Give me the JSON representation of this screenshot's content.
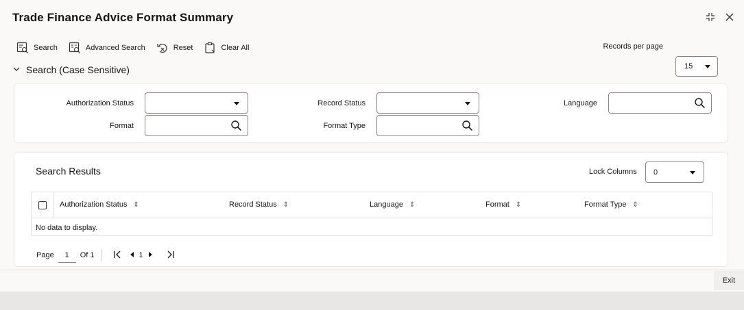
{
  "window": {
    "title": "Trade Finance Advice Format Summary"
  },
  "toolbar": {
    "search": "Search",
    "advanced_search": "Advanced Search",
    "reset": "Reset",
    "clear_all": "Clear All",
    "records_per_page_label": "Records per page",
    "records_per_page_value": "15"
  },
  "search_section": {
    "header": "Search (Case Sensitive)",
    "fields": {
      "authorization_status": {
        "label": "Authorization Status",
        "value": ""
      },
      "record_status": {
        "label": "Record Status",
        "value": ""
      },
      "language": {
        "label": "Language",
        "value": ""
      },
      "format": {
        "label": "Format",
        "value": ""
      },
      "format_type": {
        "label": "Format Type",
        "value": ""
      }
    }
  },
  "results": {
    "title": "Search Results",
    "lock_columns_label": "Lock Columns",
    "lock_columns_value": "0",
    "columns": [
      "Authorization Status",
      "Record Status",
      "Language",
      "Format",
      "Format Type"
    ],
    "empty_message": "No data to display."
  },
  "pagination": {
    "page_label": "Page",
    "current_page": "1",
    "of_label": "Of 1",
    "page_indicator": "1"
  },
  "footer": {
    "exit": "Exit"
  },
  "icons": {
    "maximize": "maximize-icon",
    "close": "close-icon",
    "search": "search-icon",
    "advanced_search": "advanced-search-icon",
    "reset": "reset-icon",
    "clear_all": "clear-all-icon"
  }
}
